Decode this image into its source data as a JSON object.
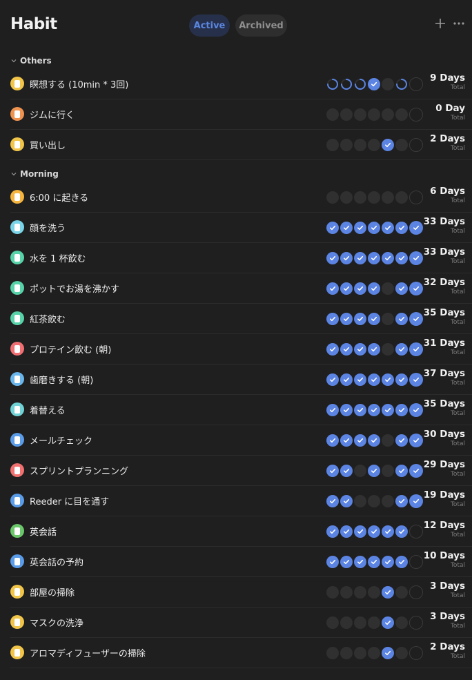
{
  "app": {
    "title": "Habit"
  },
  "tabs": {
    "active": "Active",
    "archived": "Archived"
  },
  "icons": {
    "add": "plus-icon",
    "more": "ellipsis-icon"
  },
  "sections": [
    {
      "label": "Others",
      "habits": [
        {
          "name": "瞑想する (10min * 3回)",
          "icon_color": "#f1c54a",
          "days": "9 Days",
          "total": "Total",
          "week": [
            "p",
            "p",
            "p",
            "c",
            "o",
            "p",
            "o"
          ]
        },
        {
          "name": "ジムに行く",
          "icon_color": "#ee9350",
          "days": "0 Day",
          "total": "Total",
          "week": [
            "o",
            "o",
            "o",
            "o",
            "o",
            "o",
            "o"
          ]
        },
        {
          "name": "買い出し",
          "icon_color": "#f1c54a",
          "days": "2 Days",
          "total": "Total",
          "week": [
            "o",
            "o",
            "o",
            "o",
            "c",
            "o",
            "o"
          ]
        }
      ]
    },
    {
      "label": "Morning",
      "habits": [
        {
          "name": "6:00 に起きる",
          "icon_color": "#f4b43d",
          "days": "6 Days",
          "total": "Total",
          "week": [
            "o",
            "o",
            "o",
            "o",
            "o",
            "o",
            "o"
          ]
        },
        {
          "name": "顔を洗う",
          "icon_color": "#79d4e8",
          "days": "33 Days",
          "total": "Total",
          "week": [
            "c",
            "c",
            "c",
            "c",
            "c",
            "c",
            "c"
          ]
        },
        {
          "name": "水を 1 杯飲む",
          "icon_color": "#58d3a9",
          "days": "33 Days",
          "total": "Total",
          "week": [
            "c",
            "c",
            "c",
            "c",
            "c",
            "c",
            "c"
          ]
        },
        {
          "name": "ポットでお湯を沸かす",
          "icon_color": "#58d3a9",
          "days": "32 Days",
          "total": "Total",
          "week": [
            "c",
            "c",
            "c",
            "c",
            "o",
            "c",
            "c"
          ]
        },
        {
          "name": "紅茶飲む",
          "icon_color": "#58d3a9",
          "days": "35 Days",
          "total": "Total",
          "week": [
            "c",
            "c",
            "c",
            "c",
            "o",
            "c",
            "c"
          ]
        },
        {
          "name": "プロテイン飲む (朝)",
          "icon_color": "#f06f72",
          "days": "31 Days",
          "total": "Total",
          "week": [
            "c",
            "c",
            "c",
            "c",
            "o",
            "c",
            "c"
          ]
        },
        {
          "name": "歯磨きする (朝)",
          "icon_color": "#69b6ec",
          "days": "37 Days",
          "total": "Total",
          "week": [
            "c",
            "c",
            "c",
            "c",
            "c",
            "c",
            "c"
          ]
        },
        {
          "name": "着替える",
          "icon_color": "#71d2d6",
          "days": "35 Days",
          "total": "Total",
          "week": [
            "c",
            "c",
            "c",
            "c",
            "c",
            "c",
            "c"
          ]
        },
        {
          "name": "メールチェック",
          "icon_color": "#5a9ce8",
          "days": "30 Days",
          "total": "Total",
          "week": [
            "c",
            "c",
            "c",
            "c",
            "o",
            "c",
            "c"
          ]
        },
        {
          "name": "スプリントプランニング",
          "icon_color": "#f0716f",
          "days": "29 Days",
          "total": "Total",
          "week": [
            "c",
            "c",
            "o",
            "c",
            "o",
            "c",
            "c"
          ]
        },
        {
          "name": "Reeder に目を通す",
          "icon_color": "#5a9ce8",
          "days": "19 Days",
          "total": "Total",
          "week": [
            "c",
            "c",
            "o",
            "o",
            "o",
            "c",
            "c"
          ]
        },
        {
          "name": "英会話",
          "icon_color": "#6bc86a",
          "days": "12 Days",
          "total": "Total",
          "week": [
            "c",
            "c",
            "c",
            "c",
            "c",
            "c",
            "o"
          ]
        },
        {
          "name": "英会話の予約",
          "icon_color": "#5a9ce8",
          "days": "10 Days",
          "total": "Total",
          "week": [
            "c",
            "c",
            "c",
            "c",
            "c",
            "c",
            "o"
          ]
        },
        {
          "name": "部屋の掃除",
          "icon_color": "#f1c54a",
          "days": "3 Days",
          "total": "Total",
          "week": [
            "o",
            "o",
            "o",
            "o",
            "c",
            "o",
            "o"
          ]
        },
        {
          "name": "マスクの洗浄",
          "icon_color": "#f1c54a",
          "days": "3 Days",
          "total": "Total",
          "week": [
            "o",
            "o",
            "o",
            "o",
            "c",
            "o",
            "o"
          ]
        },
        {
          "name": "アロマディフューザーの掃除",
          "icon_color": "#f1c54a",
          "days": "2 Days",
          "total": "Total",
          "week": [
            "o",
            "o",
            "o",
            "o",
            "c",
            "o",
            "o"
          ]
        }
      ]
    }
  ]
}
